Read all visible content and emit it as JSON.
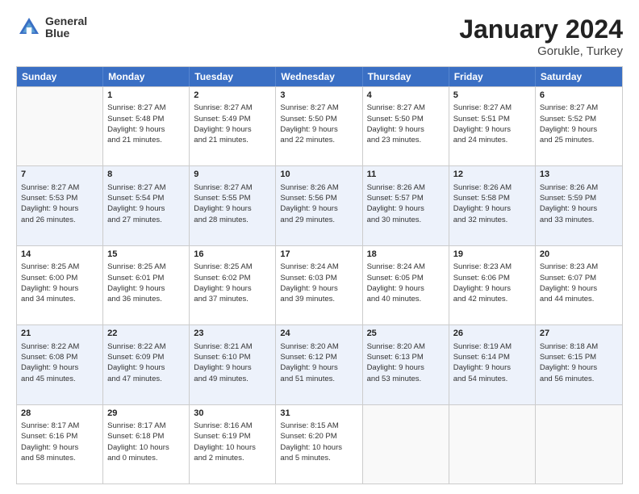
{
  "logo": {
    "line1": "General",
    "line2": "Blue"
  },
  "title": "January 2024",
  "location": "Gorukle, Turkey",
  "header_days": [
    "Sunday",
    "Monday",
    "Tuesday",
    "Wednesday",
    "Thursday",
    "Friday",
    "Saturday"
  ],
  "weeks": [
    [
      {
        "day": "",
        "lines": []
      },
      {
        "day": "1",
        "lines": [
          "Sunrise: 8:27 AM",
          "Sunset: 5:48 PM",
          "Daylight: 9 hours",
          "and 21 minutes."
        ]
      },
      {
        "day": "2",
        "lines": [
          "Sunrise: 8:27 AM",
          "Sunset: 5:49 PM",
          "Daylight: 9 hours",
          "and 21 minutes."
        ]
      },
      {
        "day": "3",
        "lines": [
          "Sunrise: 8:27 AM",
          "Sunset: 5:50 PM",
          "Daylight: 9 hours",
          "and 22 minutes."
        ]
      },
      {
        "day": "4",
        "lines": [
          "Sunrise: 8:27 AM",
          "Sunset: 5:50 PM",
          "Daylight: 9 hours",
          "and 23 minutes."
        ]
      },
      {
        "day": "5",
        "lines": [
          "Sunrise: 8:27 AM",
          "Sunset: 5:51 PM",
          "Daylight: 9 hours",
          "and 24 minutes."
        ]
      },
      {
        "day": "6",
        "lines": [
          "Sunrise: 8:27 AM",
          "Sunset: 5:52 PM",
          "Daylight: 9 hours",
          "and 25 minutes."
        ]
      }
    ],
    [
      {
        "day": "7",
        "lines": [
          "Sunrise: 8:27 AM",
          "Sunset: 5:53 PM",
          "Daylight: 9 hours",
          "and 26 minutes."
        ]
      },
      {
        "day": "8",
        "lines": [
          "Sunrise: 8:27 AM",
          "Sunset: 5:54 PM",
          "Daylight: 9 hours",
          "and 27 minutes."
        ]
      },
      {
        "day": "9",
        "lines": [
          "Sunrise: 8:27 AM",
          "Sunset: 5:55 PM",
          "Daylight: 9 hours",
          "and 28 minutes."
        ]
      },
      {
        "day": "10",
        "lines": [
          "Sunrise: 8:26 AM",
          "Sunset: 5:56 PM",
          "Daylight: 9 hours",
          "and 29 minutes."
        ]
      },
      {
        "day": "11",
        "lines": [
          "Sunrise: 8:26 AM",
          "Sunset: 5:57 PM",
          "Daylight: 9 hours",
          "and 30 minutes."
        ]
      },
      {
        "day": "12",
        "lines": [
          "Sunrise: 8:26 AM",
          "Sunset: 5:58 PM",
          "Daylight: 9 hours",
          "and 32 minutes."
        ]
      },
      {
        "day": "13",
        "lines": [
          "Sunrise: 8:26 AM",
          "Sunset: 5:59 PM",
          "Daylight: 9 hours",
          "and 33 minutes."
        ]
      }
    ],
    [
      {
        "day": "14",
        "lines": [
          "Sunrise: 8:25 AM",
          "Sunset: 6:00 PM",
          "Daylight: 9 hours",
          "and 34 minutes."
        ]
      },
      {
        "day": "15",
        "lines": [
          "Sunrise: 8:25 AM",
          "Sunset: 6:01 PM",
          "Daylight: 9 hours",
          "and 36 minutes."
        ]
      },
      {
        "day": "16",
        "lines": [
          "Sunrise: 8:25 AM",
          "Sunset: 6:02 PM",
          "Daylight: 9 hours",
          "and 37 minutes."
        ]
      },
      {
        "day": "17",
        "lines": [
          "Sunrise: 8:24 AM",
          "Sunset: 6:03 PM",
          "Daylight: 9 hours",
          "and 39 minutes."
        ]
      },
      {
        "day": "18",
        "lines": [
          "Sunrise: 8:24 AM",
          "Sunset: 6:05 PM",
          "Daylight: 9 hours",
          "and 40 minutes."
        ]
      },
      {
        "day": "19",
        "lines": [
          "Sunrise: 8:23 AM",
          "Sunset: 6:06 PM",
          "Daylight: 9 hours",
          "and 42 minutes."
        ]
      },
      {
        "day": "20",
        "lines": [
          "Sunrise: 8:23 AM",
          "Sunset: 6:07 PM",
          "Daylight: 9 hours",
          "and 44 minutes."
        ]
      }
    ],
    [
      {
        "day": "21",
        "lines": [
          "Sunrise: 8:22 AM",
          "Sunset: 6:08 PM",
          "Daylight: 9 hours",
          "and 45 minutes."
        ]
      },
      {
        "day": "22",
        "lines": [
          "Sunrise: 8:22 AM",
          "Sunset: 6:09 PM",
          "Daylight: 9 hours",
          "and 47 minutes."
        ]
      },
      {
        "day": "23",
        "lines": [
          "Sunrise: 8:21 AM",
          "Sunset: 6:10 PM",
          "Daylight: 9 hours",
          "and 49 minutes."
        ]
      },
      {
        "day": "24",
        "lines": [
          "Sunrise: 8:20 AM",
          "Sunset: 6:12 PM",
          "Daylight: 9 hours",
          "and 51 minutes."
        ]
      },
      {
        "day": "25",
        "lines": [
          "Sunrise: 8:20 AM",
          "Sunset: 6:13 PM",
          "Daylight: 9 hours",
          "and 53 minutes."
        ]
      },
      {
        "day": "26",
        "lines": [
          "Sunrise: 8:19 AM",
          "Sunset: 6:14 PM",
          "Daylight: 9 hours",
          "and 54 minutes."
        ]
      },
      {
        "day": "27",
        "lines": [
          "Sunrise: 8:18 AM",
          "Sunset: 6:15 PM",
          "Daylight: 9 hours",
          "and 56 minutes."
        ]
      }
    ],
    [
      {
        "day": "28",
        "lines": [
          "Sunrise: 8:17 AM",
          "Sunset: 6:16 PM",
          "Daylight: 9 hours",
          "and 58 minutes."
        ]
      },
      {
        "day": "29",
        "lines": [
          "Sunrise: 8:17 AM",
          "Sunset: 6:18 PM",
          "Daylight: 10 hours",
          "and 0 minutes."
        ]
      },
      {
        "day": "30",
        "lines": [
          "Sunrise: 8:16 AM",
          "Sunset: 6:19 PM",
          "Daylight: 10 hours",
          "and 2 minutes."
        ]
      },
      {
        "day": "31",
        "lines": [
          "Sunrise: 8:15 AM",
          "Sunset: 6:20 PM",
          "Daylight: 10 hours",
          "and 5 minutes."
        ]
      },
      {
        "day": "",
        "lines": []
      },
      {
        "day": "",
        "lines": []
      },
      {
        "day": "",
        "lines": []
      }
    ]
  ]
}
